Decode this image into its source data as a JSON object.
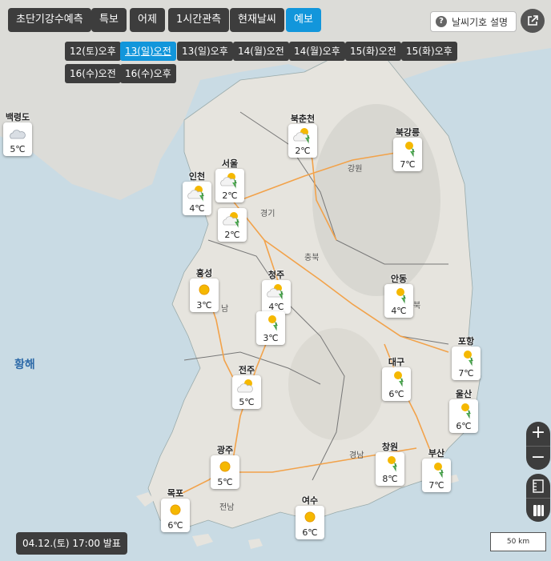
{
  "tabs": [
    {
      "label": "초단기강수예측",
      "active": false
    },
    {
      "label": "특보",
      "active": false
    },
    {
      "label": "어제",
      "active": false
    },
    {
      "label": "1시간관측",
      "active": false
    },
    {
      "label": "현재날씨",
      "active": false
    },
    {
      "label": "예보",
      "active": true
    }
  ],
  "time_buttons": [
    {
      "label": "12(토)오후",
      "active": false
    },
    {
      "label": "13(일)오전",
      "active": true
    },
    {
      "label": "13(일)오후",
      "active": false
    },
    {
      "label": "14(월)오전",
      "active": false
    },
    {
      "label": "14(월)오후",
      "active": false
    },
    {
      "label": "15(화)오전",
      "active": false
    },
    {
      "label": "15(화)오후",
      "active": false
    },
    {
      "label": "16(수)오전",
      "active": false
    },
    {
      "label": "16(수)오후",
      "active": false
    }
  ],
  "legend_button": {
    "label": "날씨기호 설명",
    "icon": "question-icon"
  },
  "external_icon": "external-link-icon",
  "cities": [
    {
      "name": "백령도",
      "temp": "5℃",
      "weather": "cloudy"
    },
    {
      "name": "인천",
      "temp": "4℃",
      "weather": "sun-cloud-rain"
    },
    {
      "name": "서울",
      "temp": "2℃",
      "weather": "sun-cloud-rain"
    },
    {
      "name": "",
      "temp": "2℃",
      "weather": "sun-cloud-rain"
    },
    {
      "name": "북춘천",
      "temp": "2℃",
      "weather": "sun-cloud-rain"
    },
    {
      "name": "북강릉",
      "temp": "7℃",
      "weather": "sun-rain"
    },
    {
      "name": "홍성",
      "temp": "3℃",
      "weather": "sunny"
    },
    {
      "name": "청주",
      "temp": "4℃",
      "weather": "sun-cloud-rain"
    },
    {
      "name": "",
      "temp": "3℃",
      "weather": "sun-rain"
    },
    {
      "name": "안동",
      "temp": "4℃",
      "weather": "sun-rain"
    },
    {
      "name": "포항",
      "temp": "7℃",
      "weather": "sun-rain"
    },
    {
      "name": "대구",
      "temp": "6℃",
      "weather": "sun-rain"
    },
    {
      "name": "울산",
      "temp": "6℃",
      "weather": "sun-rain"
    },
    {
      "name": "전주",
      "temp": "5℃",
      "weather": "sun-cloud"
    },
    {
      "name": "광주",
      "temp": "5℃",
      "weather": "sunny"
    },
    {
      "name": "창원",
      "temp": "8℃",
      "weather": "sun-rain"
    },
    {
      "name": "부산",
      "temp": "7℃",
      "weather": "sun-rain"
    },
    {
      "name": "목포",
      "temp": "6℃",
      "weather": "sunny"
    },
    {
      "name": "여수",
      "temp": "6℃",
      "weather": "sunny"
    }
  ],
  "regions": [
    "강원",
    "경기",
    "충북",
    "북",
    "남",
    "경남",
    "전남"
  ],
  "sea_label": "황해",
  "zoom": {
    "in": "+",
    "out": "−"
  },
  "tools": [
    "ruler-icon",
    "layers-icon"
  ],
  "issued": "04.12.(토) 17:00 발표",
  "scale": "50 km",
  "colors": {
    "tab_bg": "#3d3d3d",
    "accent": "#1296db",
    "sea": "#c9dbe4",
    "land": "#e8e6e1"
  }
}
